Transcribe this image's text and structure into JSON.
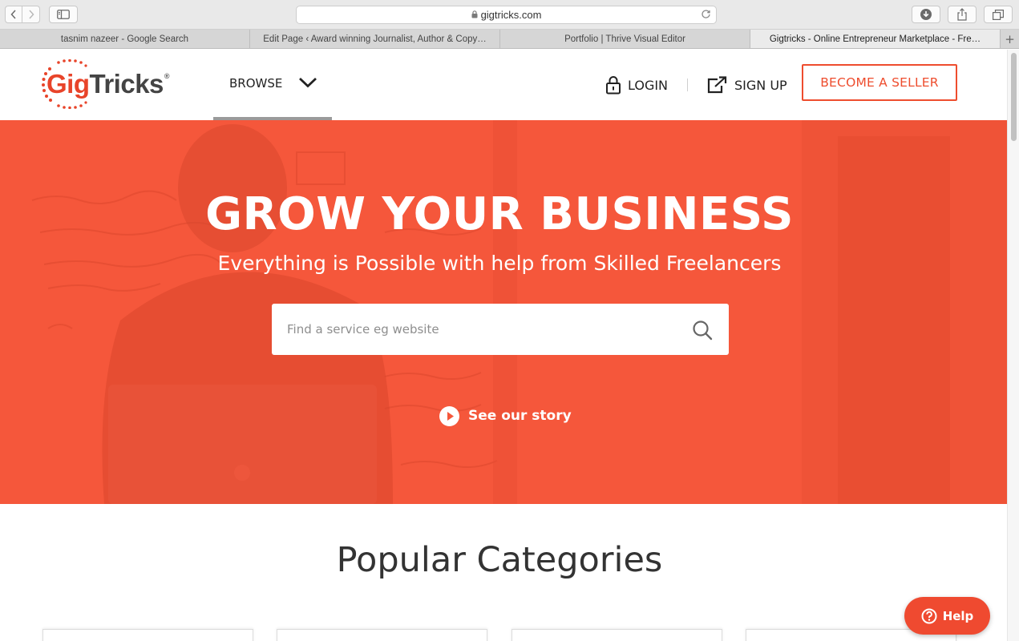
{
  "browser": {
    "url": "gigtricks.com",
    "tabs": [
      {
        "label": "tasnim nazeer - Google Search",
        "active": false
      },
      {
        "label": "Edit Page ‹ Award winning Journalist, Author & Copy…",
        "active": false
      },
      {
        "label": "Portfolio | Thrive Visual Editor",
        "active": false
      },
      {
        "label": "Gigtricks - Online Entrepreneur Marketplace - Fre…",
        "active": true
      }
    ],
    "new_tab_symbol": "+"
  },
  "header": {
    "logo": {
      "gig": "Gig",
      "tricks": "Tricks",
      "reg": "®"
    },
    "browse_label": "BROWSE",
    "login_label": "LOGIN",
    "divider": "|",
    "signup_label": "SIGN UP",
    "seller_label": "BECOME A SELLER"
  },
  "hero": {
    "title": "GROW YOUR BUSINESS",
    "subtitle": "Everything is Possible with help from Skilled Freelancers",
    "search_placeholder": "Find a service eg website",
    "search_value": "",
    "story_label": "See our story"
  },
  "categories": {
    "title": "Popular Categories"
  },
  "help": {
    "label": "Help"
  },
  "colors": {
    "brand": "#ee4d2e",
    "hero_overlay": "#f5573b",
    "help_button": "#ef4a30"
  },
  "icons": {
    "back": "chevron-left-icon",
    "forward": "chevron-right-icon",
    "sidebar": "sidebar-icon",
    "lock": "lock-icon",
    "reload": "reload-icon",
    "downloads": "download-icon",
    "share": "share-icon",
    "tabs": "tabs-icon",
    "browse": "chevron-down-icon",
    "login": "padlock-icon",
    "signup": "external-link-icon",
    "search": "search-icon",
    "story": "play-icon",
    "help": "question-icon"
  }
}
